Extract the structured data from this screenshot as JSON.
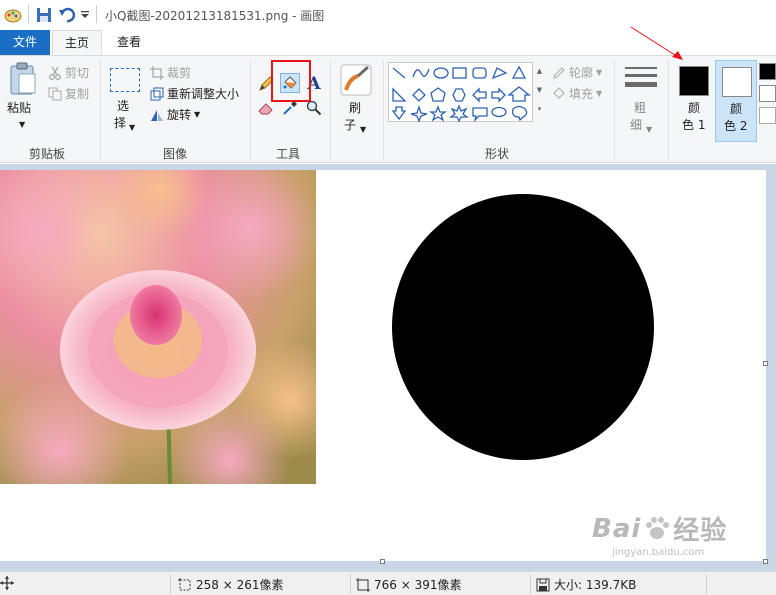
{
  "titlebar": {
    "title": "小Q截图-20201213181531.png - 画图",
    "icons": [
      "paint-app-icon",
      "save-icon",
      "undo-icon",
      "customize-quick-access-icon"
    ]
  },
  "tabs": [
    {
      "label": "文件",
      "active": false
    },
    {
      "label": "主页",
      "active": true
    },
    {
      "label": "查看",
      "active": false
    }
  ],
  "ribbon": {
    "clipboard": {
      "group_label": "剪贴板",
      "paste": "粘贴",
      "cut": "剪切",
      "copy": "复制"
    },
    "image": {
      "group_label": "图像",
      "select_line1": "选",
      "select_line2": "择",
      "crop": "裁剪",
      "resize": "重新调整大小",
      "rotate": "旋转"
    },
    "tools": {
      "group_label": "工具",
      "items": [
        "pencil",
        "fill-with-color",
        "text",
        "eraser",
        "color-picker",
        "magnifier"
      ],
      "selected": "fill-with-color"
    },
    "brushes": {
      "line1": "刷",
      "line2": "子"
    },
    "shapes": {
      "group_label": "形状",
      "outline": "轮廓",
      "fill": "填充"
    },
    "size": {
      "line1": "粗",
      "line2": "细"
    },
    "colors": {
      "color1_line1": "颜",
      "color1_line2": "色 1",
      "color1_value": "#000000",
      "color2_line1": "颜",
      "color2_line2": "色 2",
      "color2_value": "#ffffff"
    }
  },
  "colors": {
    "accent": "#1a6fc4",
    "highlight": "#e8141b",
    "canvas_bg": "#c9d6e7"
  },
  "status": {
    "selection_size": "258 × 261像素",
    "image_size": "766 × 391像素",
    "file_size": "大小: 139.7KB"
  },
  "watermark": {
    "brand": "Bai",
    "brand_cn": "经验",
    "url": "jingyan.baidu.com"
  }
}
